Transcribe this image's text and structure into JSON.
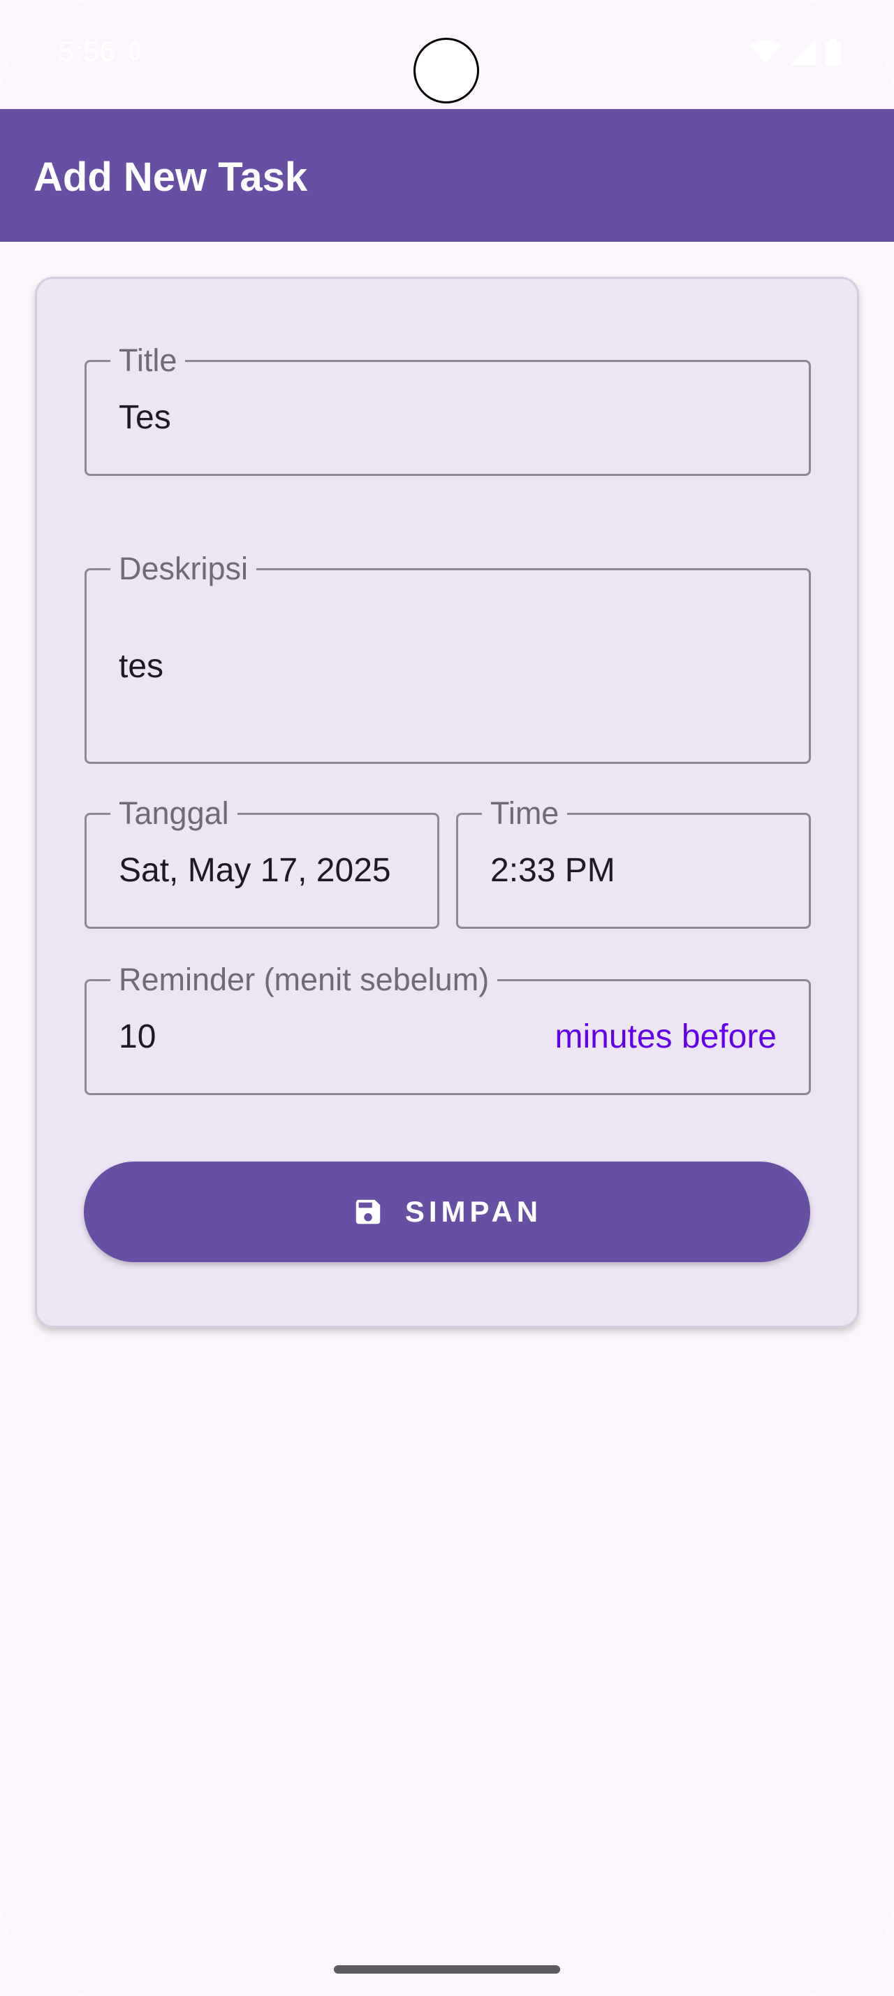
{
  "status_bar": {
    "time": "5:56"
  },
  "app_bar": {
    "title": "Add New Task"
  },
  "form": {
    "title": {
      "label": "Title",
      "value": "Tes"
    },
    "description": {
      "label": "Deskripsi",
      "value": "tes"
    },
    "date": {
      "label": "Tanggal",
      "value": "Sat, May 17, 2025"
    },
    "time": {
      "label": "Time",
      "value": "2:33 PM"
    },
    "reminder": {
      "label": "Reminder (menit sebelum)",
      "value": "10",
      "suffix": "minutes before"
    },
    "save_label": "SIMPAN"
  },
  "colors": {
    "primary": "#6750a4",
    "suffix": "#6200ee",
    "card": "#ede5f4",
    "background": "#fcf5fc"
  },
  "icons": {
    "save": "save-icon",
    "wifi": "wifi-icon",
    "signal": "signal-icon",
    "battery": "battery-icon"
  }
}
